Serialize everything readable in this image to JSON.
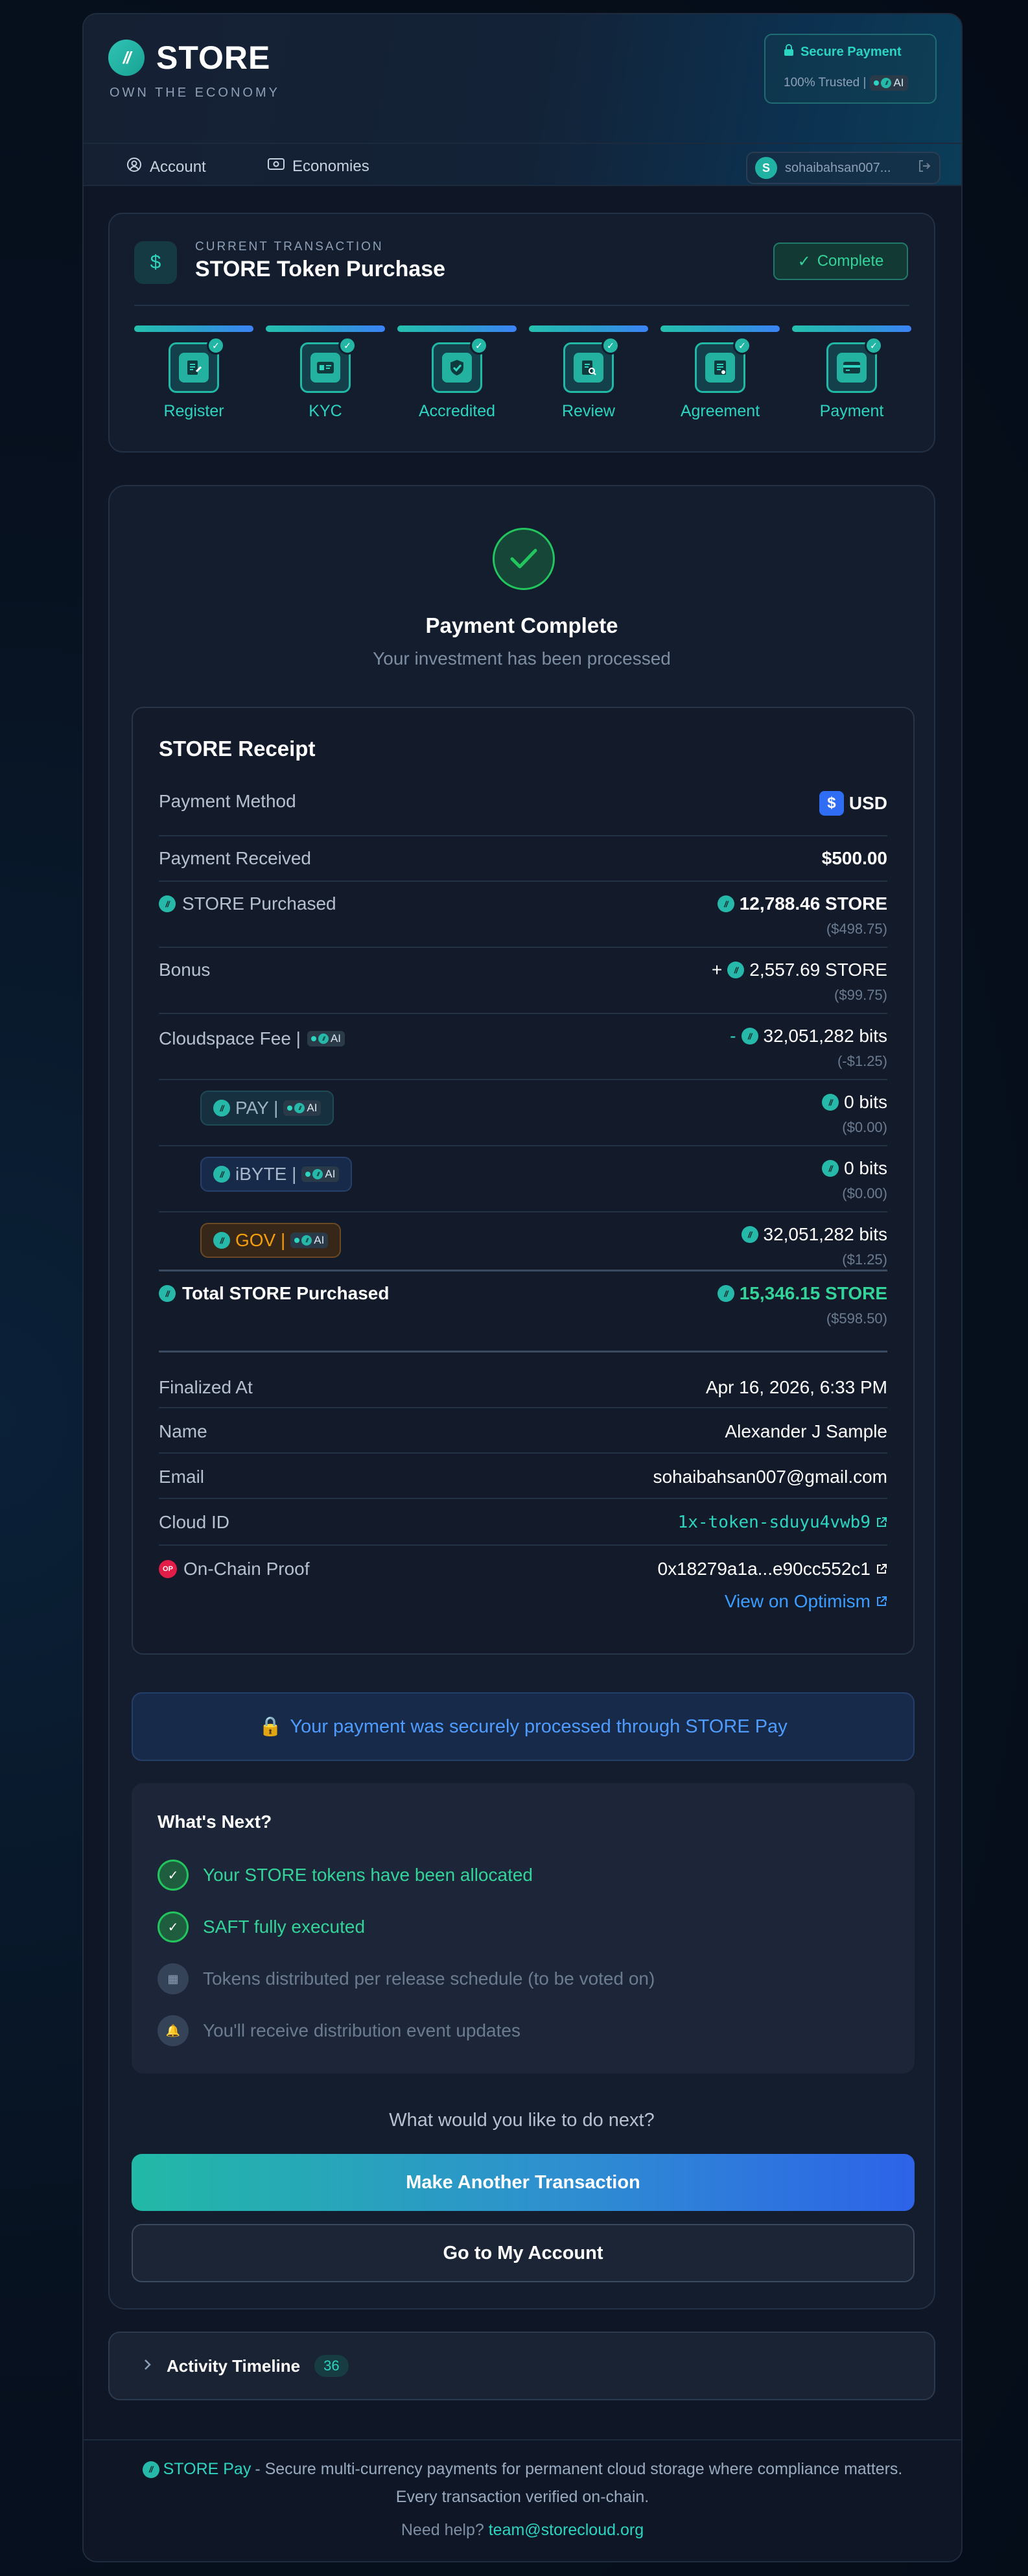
{
  "header": {
    "brand": "STORE",
    "tagline": "OWN THE ECONOMY",
    "secure_title": "Secure Payment",
    "secure_sub": "100% Trusted |",
    "ai_label": "AI"
  },
  "nav": {
    "account": "Account",
    "economies": "Economies",
    "user_initial": "S",
    "user_name": "sohaibahsan007..."
  },
  "transaction": {
    "eyebrow": "CURRENT TRANSACTION",
    "title": "STORE Token Purchase",
    "status": "Complete",
    "steps": [
      "Register",
      "KYC",
      "Accredited",
      "Review",
      "Agreement",
      "Payment"
    ]
  },
  "payment": {
    "title": "Payment Complete",
    "subtitle": "Your investment has been processed"
  },
  "receipt": {
    "title": "STORE Receipt",
    "method_label": "Payment Method",
    "method_icon": "$",
    "method_value": "USD",
    "received_label": "Payment Received",
    "received_value": "$500.00",
    "purchased_label": "STORE Purchased",
    "purchased_value": "12,788.46 STORE",
    "purchased_usd": "($498.75)",
    "bonus_label": "Bonus",
    "bonus_prefix": "+",
    "bonus_value": "2,557.69 STORE",
    "bonus_usd": "($99.75)",
    "fee_label": "Cloudspace Fee |",
    "fee_prefix": "-",
    "fee_value": "32,051,282 bits",
    "fee_usd": "(-$1.25)",
    "pay_label": "PAY |",
    "pay_value": "0 bits",
    "pay_usd": "($0.00)",
    "ibyte_label": "iBYTE |",
    "ibyte_value": "0 bits",
    "ibyte_usd": "($0.00)",
    "gov_label": "GOV |",
    "gov_value": "32,051,282 bits",
    "gov_usd": "($1.25)",
    "total_label": "Total STORE Purchased",
    "total_value": "15,346.15 STORE",
    "total_usd": "($598.50)",
    "finalized_label": "Finalized At",
    "finalized_value": "Apr 16, 2026, 6:33 PM",
    "name_label": "Name",
    "name_value": "Alexander J Sample",
    "email_label": "Email",
    "email_value": "sohaibahsan007@gmail.com",
    "cloud_label": "Cloud ID",
    "cloud_value": "1x-token-sduyu4vwb9",
    "proof_label": "On-Chain Proof",
    "proof_icon": "OP",
    "proof_value": "0x18279a1a...e90cc552c1",
    "optimism_link": "View on Optimism"
  },
  "secure_note": "Your payment was securely processed through STORE Pay",
  "next": {
    "title": "What's Next?",
    "items": [
      "Your STORE tokens have been allocated",
      "SAFT fully executed",
      "Tokens distributed per release schedule (to be voted on)",
      "You'll receive distribution event updates"
    ],
    "question": "What would you like to do next?",
    "primary_button": "Make Another Transaction",
    "secondary_button": "Go to My Account"
  },
  "timeline": {
    "title": "Activity Timeline",
    "count": "36"
  },
  "footer": {
    "brand": "STORE Pay",
    "line1": "- Secure multi-currency payments for permanent cloud storage where compliance matters.",
    "line2": "Every transaction verified on-chain.",
    "help": "Need help?",
    "email": "team@storecloud.org"
  },
  "colors": {
    "accent_teal": "#2dd4bf",
    "success_green": "#34d399",
    "link_blue": "#3b9dff",
    "gov_orange": "#f59e0b"
  },
  "icons": [
    "logo-icon",
    "lock-icon",
    "account-icon",
    "economies-icon",
    "logout-icon",
    "dollar-icon",
    "check-icon",
    "chevron-right-icon"
  ]
}
